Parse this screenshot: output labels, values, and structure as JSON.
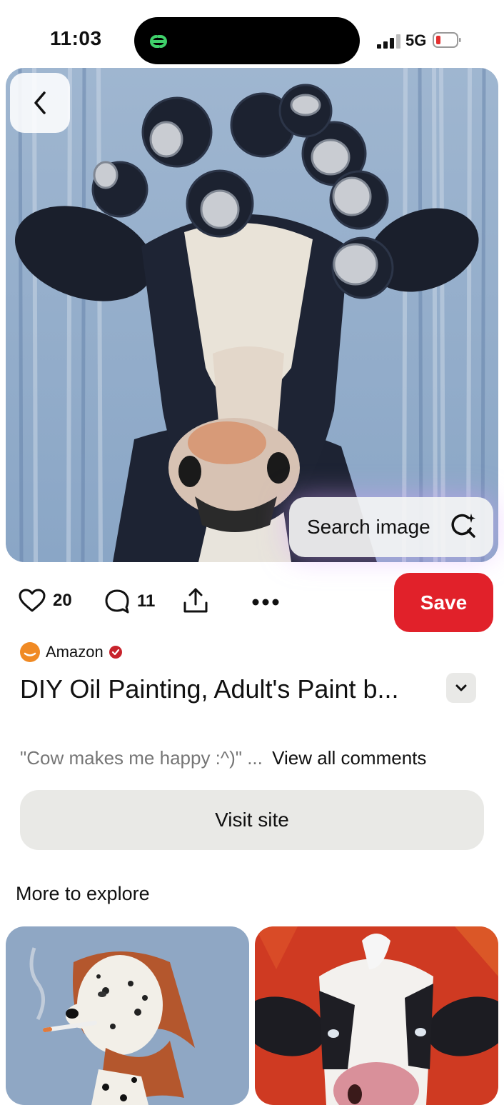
{
  "status_bar": {
    "time": "11:03",
    "network": "5G",
    "icons": [
      "app-link-icon",
      "signal-icon",
      "battery-low-icon"
    ]
  },
  "hero": {
    "back_icon": "chevron-left-icon",
    "search_image_label": "Search image",
    "search_image_icon": "visual-search-sparkle-icon"
  },
  "actions": {
    "like_count": "20",
    "comment_count": "11",
    "icons": [
      "heart-icon",
      "comment-bubble-icon",
      "share-upload-icon",
      "more-dots-icon"
    ],
    "save_label": "Save"
  },
  "pin": {
    "source_name": "Amazon",
    "title": "DIY Oil Painting, Adult's Paint b...",
    "comment_preview": "\"Cow makes me happy :^)\" ...",
    "view_all_label": "View all comments",
    "visit_site_label": "Visit site"
  },
  "explore": {
    "title": "More to explore"
  },
  "colors": {
    "save": "#e1212a",
    "accent_verified": "#c8232c",
    "source_logo": "#f08a24",
    "button_bg": "#e9e9e6"
  }
}
